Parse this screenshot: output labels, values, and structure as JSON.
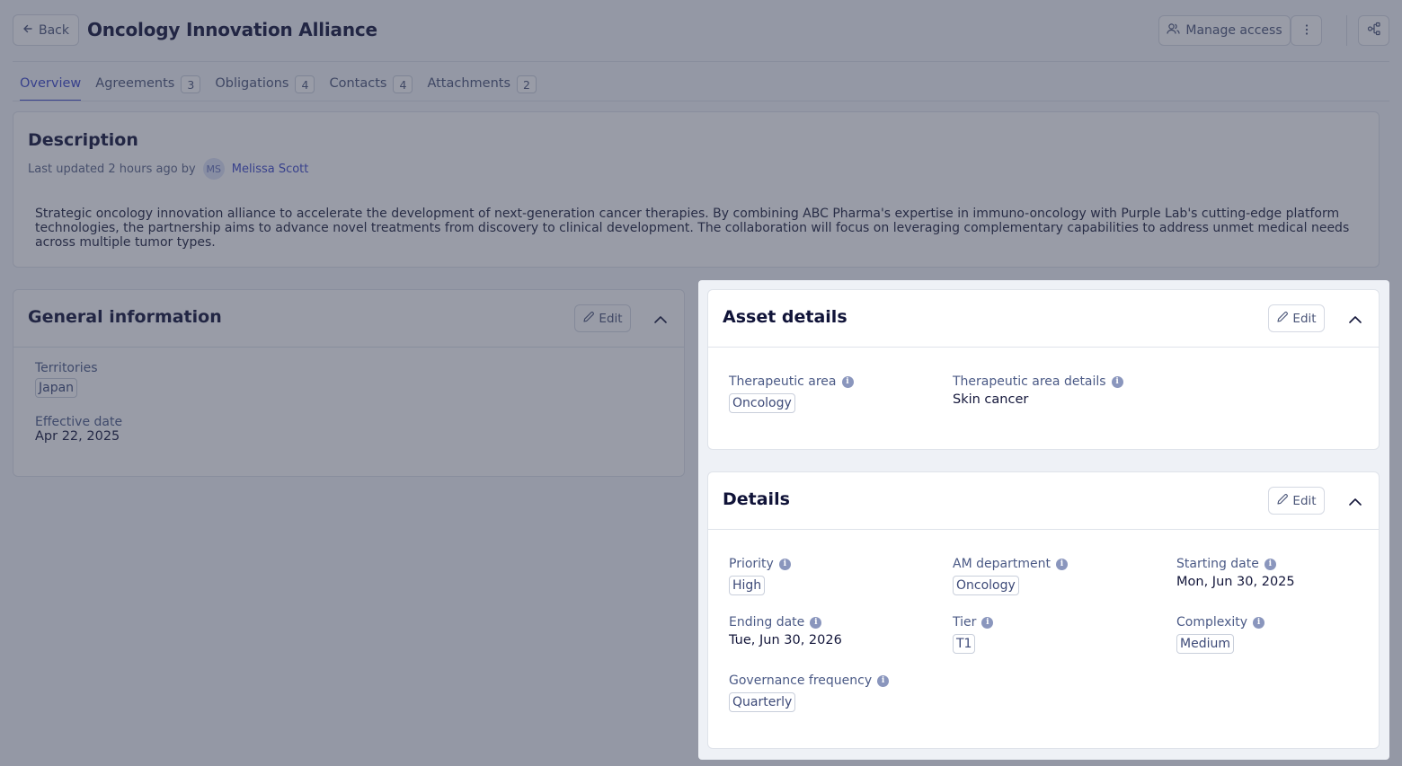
{
  "header": {
    "back_label": "Back",
    "title": "Oncology Innovation Alliance",
    "manage_access_label": "Manage access"
  },
  "tabs": [
    {
      "label": "Overview",
      "count": ""
    },
    {
      "label": "Agreements",
      "count": "3"
    },
    {
      "label": "Obligations",
      "count": "4"
    },
    {
      "label": "Contacts",
      "count": "4"
    },
    {
      "label": "Attachments",
      "count": "2"
    }
  ],
  "description": {
    "title": "Description",
    "updated_prefix": "Last updated 2 hours ago by",
    "author_initials": "MS",
    "author_name": "Melissa Scott",
    "text": "Strategic oncology innovation alliance to accelerate the development of next-generation cancer therapies. By combining ABC Pharma's expertise in immuno-oncology with Purple Lab's cutting-edge platform technologies, the partnership aims to advance novel treatments from discovery to clinical development. The collaboration will focus on leveraging complementary capabilities to address unmet medical needs across multiple tumor types."
  },
  "general_info": {
    "title": "General information",
    "edit_label": "Edit",
    "territories_label": "Territories",
    "territories_value": "Japan",
    "effective_date_label": "Effective date",
    "effective_date_value": "Apr 22, 2025"
  },
  "asset_details": {
    "title": "Asset details",
    "edit_label": "Edit",
    "therapeutic_area_label": "Therapeutic area",
    "therapeutic_area_value": "Oncology",
    "therapeutic_area_details_label": "Therapeutic area details",
    "therapeutic_area_details_value": "Skin cancer"
  },
  "details": {
    "title": "Details",
    "edit_label": "Edit",
    "priority_label": "Priority",
    "priority_value": "High",
    "am_department_label": "AM department",
    "am_department_value": "Oncology",
    "starting_date_label": "Starting date",
    "starting_date_value": "Mon, Jun 30, 2025",
    "ending_date_label": "Ending date",
    "ending_date_value": "Tue, Jun 30, 2026",
    "tier_label": "Tier",
    "tier_value": "T1",
    "complexity_label": "Complexity",
    "complexity_value": "Medium",
    "governance_frequency_label": "Governance frequency",
    "governance_frequency_value": "Quarterly"
  },
  "colors": {
    "accent": "#3b47c8",
    "overlay": "#343a50",
    "panel_bg": "#eef1f6"
  }
}
